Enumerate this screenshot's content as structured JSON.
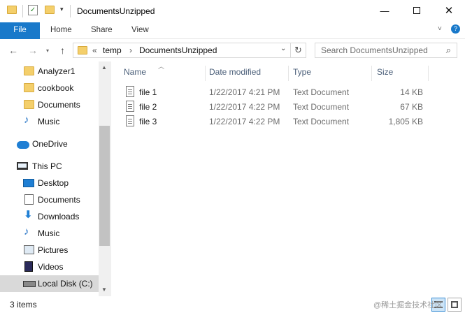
{
  "window": {
    "title": "DocumentsUnzipped",
    "minimize_icon": "minimize-icon",
    "maximize_icon": "maximize-icon",
    "close_icon": "close-icon"
  },
  "ribbon": {
    "tabs": [
      {
        "label": "File"
      },
      {
        "label": "Home"
      },
      {
        "label": "Share"
      },
      {
        "label": "View"
      }
    ],
    "file_tab_color": "#1979ca"
  },
  "address": {
    "overflow": "«",
    "crumbs": [
      "temp",
      "DocumentsUnzipped"
    ],
    "separator": "›"
  },
  "search": {
    "placeholder": "Search DocumentsUnzipped"
  },
  "nav_pane": {
    "items": [
      {
        "label": "Analyzer1",
        "icon": "folder-icon"
      },
      {
        "label": "cookbook",
        "icon": "folder-icon"
      },
      {
        "label": "Documents",
        "icon": "folder-icon"
      },
      {
        "label": "Music",
        "icon": "music-icon"
      },
      {
        "label": "OneDrive",
        "icon": "onedrive-icon"
      },
      {
        "label": "This PC",
        "icon": "this-pc-icon"
      },
      {
        "label": "Desktop",
        "icon": "desktop-icon"
      },
      {
        "label": "Documents",
        "icon": "documents-icon"
      },
      {
        "label": "Downloads",
        "icon": "downloads-icon"
      },
      {
        "label": "Music",
        "icon": "music-icon"
      },
      {
        "label": "Pictures",
        "icon": "pictures-icon"
      },
      {
        "label": "Videos",
        "icon": "videos-icon"
      },
      {
        "label": "Local Disk (C:)",
        "icon": "local-disk-icon",
        "selected": true
      }
    ]
  },
  "file_list": {
    "columns": [
      "Name",
      "Date modified",
      "Type",
      "Size"
    ],
    "rows": [
      {
        "name": "file 1",
        "date": "1/22/2017 4:21 PM",
        "type": "Text Document",
        "size": "14 KB"
      },
      {
        "name": "file 2",
        "date": "1/22/2017 4:22 PM",
        "type": "Text Document",
        "size": "67 KB"
      },
      {
        "name": "file 3",
        "date": "1/22/2017 4:22 PM",
        "type": "Text Document",
        "size": "1,805 KB"
      }
    ]
  },
  "status": {
    "item_count": "3 items",
    "watermark": "@稀土掘金技术社区"
  }
}
